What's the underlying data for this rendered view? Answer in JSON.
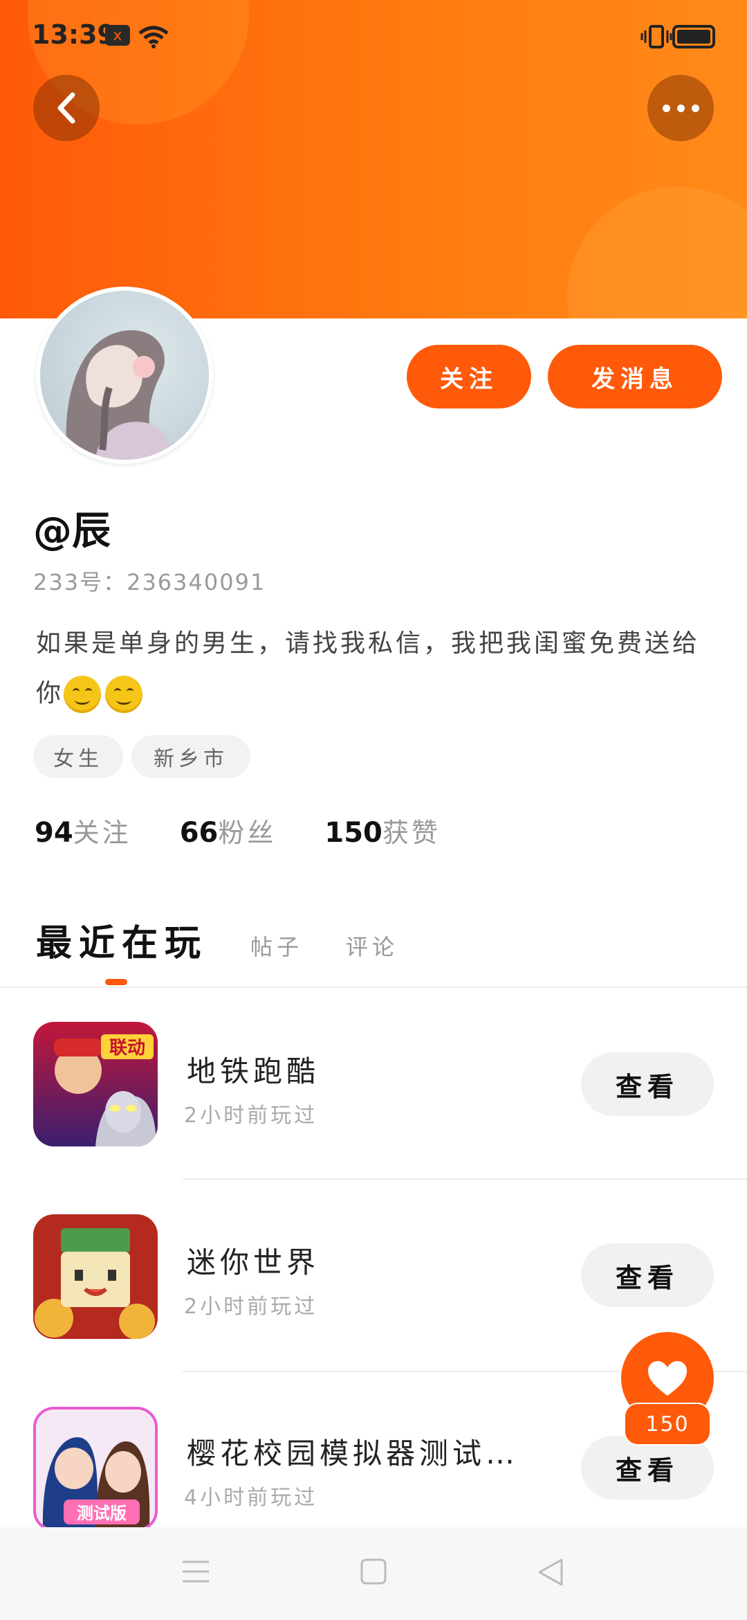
{
  "status_bar": {
    "time": "13:39",
    "notif_icon": "x"
  },
  "profile": {
    "username": "@辰",
    "uid": "233号：236340091",
    "bio": "如果是单身的男生，请找我私信，我把我闺蜜免费送给你",
    "tags": [
      "女生",
      "新乡市"
    ]
  },
  "actions": {
    "follow": "关注",
    "message": "发消息"
  },
  "stats": [
    {
      "num": "94",
      "label": "关注"
    },
    {
      "num": "66",
      "label": "粉丝"
    },
    {
      "num": "150",
      "label": "获赞"
    }
  ],
  "tabs": {
    "active": "最近在玩",
    "others": [
      "帖子",
      "评论"
    ]
  },
  "games": [
    {
      "name": "地铁跑酷",
      "time": "2小时前玩过",
      "button": "查看",
      "icon_badge": "联动"
    },
    {
      "name": "迷你世界",
      "time": "2小时前玩过",
      "button": "查看"
    },
    {
      "name": "樱花校园模拟器测试…",
      "time": "4小时前玩过",
      "button": "查看",
      "icon_badge": "测试版"
    }
  ],
  "like_fab": {
    "count": "150"
  },
  "colors": {
    "accent": "#ff5a0a",
    "header_gradient_end": "#ff8a1a"
  }
}
